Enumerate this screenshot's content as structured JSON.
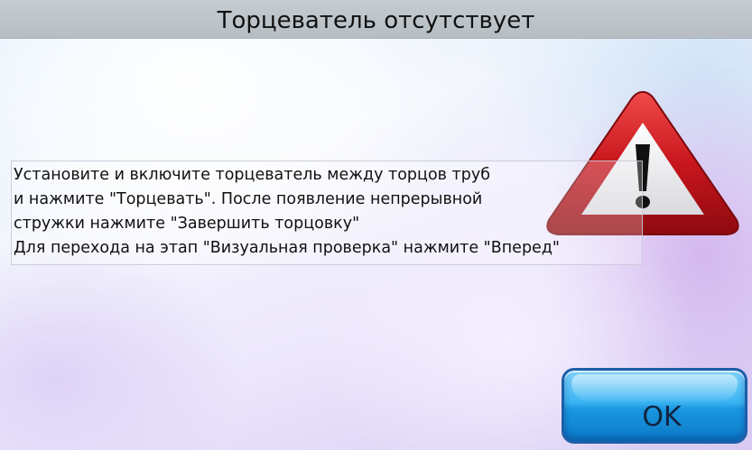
{
  "window": {
    "title": "Торцеватель отсутствует"
  },
  "message": {
    "lines": [
      "Установите и включите торцеватель между торцов труб",
      "и нажмите \"Торцевать\". После появление непрерывной",
      "стружки нажмите \"Завершить торцовку\"",
      "Для перехода на этап \"Визуальная проверка\" нажмите \"Вперед\""
    ]
  },
  "icons": {
    "warning": "warning-triangle-icon"
  },
  "buttons": {
    "ok_label": "OK"
  },
  "colors": {
    "titlebar": "#bcc4ca",
    "warning_red": "#c8161d",
    "button_blue": "#2aa6ea"
  }
}
